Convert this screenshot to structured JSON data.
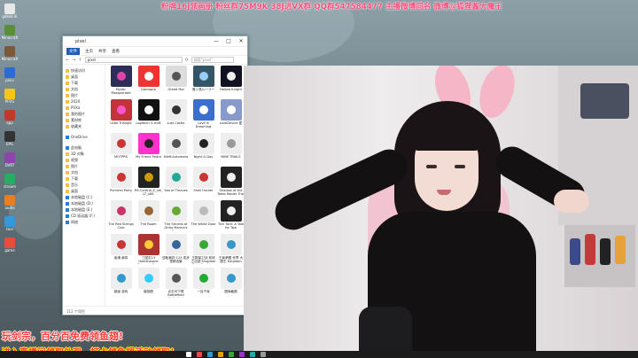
{
  "banner": {
    "text": "粉牌16J领画册 粉丝群75M9K 38J进VX群 QQ群547584477 主播微博同名 微博@狐狸酱大魔王"
  },
  "desktop_icons": [
    {
      "label": "gdkeb IE",
      "color": "#e8e8e8"
    },
    {
      "label": "Minecraft",
      "color": "#5a8f3a"
    },
    {
      "label": "Minecraft",
      "color": "#7a5a3a"
    },
    {
      "label": "pixiv",
      "color": "#2a6bd6"
    },
    {
      "label": "PFRG",
      "color": "#f5c518"
    },
    {
      "label": "app",
      "color": "#c0392b"
    },
    {
      "label": "EPG",
      "color": "#333"
    },
    {
      "label": "DVRT",
      "color": "#8e44ad"
    },
    {
      "label": "stream",
      "color": "#27ae60"
    },
    {
      "label": "audio",
      "color": "#e67e22"
    },
    {
      "label": "tool",
      "color": "#3498db"
    },
    {
      "label": "game",
      "color": "#e74c3c"
    }
  ],
  "explorer": {
    "title": "pixel",
    "ribbon_tabs": [
      "文件",
      "主页",
      "共享",
      "查看"
    ],
    "address": "pixel",
    "search_placeholder": "搜索\"pixel\"",
    "controls": {
      "minimize": "—",
      "maximize": "□",
      "close": "✕"
    },
    "nav_items": [
      {
        "label": "快速访问",
        "type": "star"
      },
      {
        "label": "桌面",
        "type": "folder"
      },
      {
        "label": "下载",
        "type": "folder"
      },
      {
        "label": "文档",
        "type": "folder"
      },
      {
        "label": "图片",
        "type": "folder"
      },
      {
        "label": "2020",
        "type": "folder"
      },
      {
        "label": "PVXa",
        "type": "folder"
      },
      {
        "label": "我的图片",
        "type": "folder"
      },
      {
        "label": "素材库",
        "type": "folder"
      },
      {
        "label": "收藏夹",
        "type": "folder"
      },
      {
        "label": "OneDrive",
        "type": "cloud"
      },
      {
        "label": "此电脑",
        "type": "pc"
      },
      {
        "label": "3D 对象",
        "type": "folder"
      },
      {
        "label": "视频",
        "type": "folder"
      },
      {
        "label": "图片",
        "type": "folder"
      },
      {
        "label": "文档",
        "type": "folder"
      },
      {
        "label": "下载",
        "type": "folder"
      },
      {
        "label": "音乐",
        "type": "folder"
      },
      {
        "label": "桌面",
        "type": "folder"
      },
      {
        "label": "本地磁盘 (C:)",
        "type": "drive"
      },
      {
        "label": "本地磁盘 (D:)",
        "type": "drive"
      },
      {
        "label": "本地磁盘 (E:)",
        "type": "drive"
      },
      {
        "label": "CD 驱动器 (F:)",
        "type": "drive"
      },
      {
        "label": "网络",
        "type": "net"
      }
    ],
    "files": [
      {
        "name": "Mystic Masquerade",
        "color": "#2d2d5a",
        "accent": "#d4a"
      },
      {
        "name": "Gomopra",
        "color": "#e33",
        "accent": "#fff"
      },
      {
        "name": "Greed Mol",
        "color": "#ddd",
        "accent": "#555"
      },
      {
        "name": "鬼ヶ島ルーラー",
        "color": "#356",
        "accent": "#9cf"
      },
      {
        "name": "Hollow Knight",
        "color": "#112",
        "accent": "#eee"
      },
      {
        "name": "Little Triangle",
        "color": "#c4323a",
        "accent": "#f5c"
      },
      {
        "name": "Logitech G HUB",
        "color": "#111",
        "accent": "#fff"
      },
      {
        "name": "Lust Castle",
        "color": "#eee",
        "accent": "#333"
      },
      {
        "name": "Love Is Dreaming",
        "color": "#3a6fd0",
        "accent": "#fff"
      },
      {
        "name": "LoveDevice 愛",
        "color": "#89c",
        "accent": "#fff"
      },
      {
        "name": "MOTPRS",
        "color": "#eee",
        "accent": "#c33"
      },
      {
        "name": "My Friend Pedro",
        "color": "#f3c",
        "accent": "#222"
      },
      {
        "name": "NieR:Automata",
        "color": "#eee",
        "accent": "#555"
      },
      {
        "name": "Night & Day",
        "color": "#eee",
        "accent": "#222"
      },
      {
        "name": "NINE TRAILS",
        "color": "#eee",
        "accent": "#999"
      },
      {
        "name": "Pummel Party",
        "color": "#eee",
        "accent": "#c33"
      },
      {
        "name": "RE:Central_E_ret_COLR_DEFAU LT_x64",
        "color": "#222",
        "accent": "#c90"
      },
      {
        "name": "Sea of Thieves",
        "color": "#eee",
        "accent": "#2a9"
      },
      {
        "name": "Shell Hunter",
        "color": "#eee",
        "accent": "#c33"
      },
      {
        "name": "Shadow of the Tomb Raider Trial",
        "color": "#222",
        "accent": "#eee"
      },
      {
        "name": "The Red Strings Club",
        "color": "#eee",
        "accent": "#c36"
      },
      {
        "name": "The Room",
        "color": "#eee",
        "accent": "#963"
      },
      {
        "name": "The Secrets of Ghita Marma's Curse",
        "color": "#eee",
        "accent": "#6a3"
      },
      {
        "name": "The White Door",
        "color": "#eee",
        "accent": "#bbb"
      },
      {
        "name": "Tick Tock: A Tale for Two",
        "color": "#222",
        "accent": "#eee"
      },
      {
        "name": "雀魂 麻将",
        "color": "#eee",
        "accent": "#c33"
      },
      {
        "name": "三国志13 Hearthstone Stranger Case Files",
        "color": "#a33",
        "accent": "#fc3"
      },
      {
        "name": "逆転裁判 123 成步堂精选集",
        "color": "#eee",
        "accent": "#369"
      },
      {
        "name": "王国保卫战 前线 之丝绒 Kingdom Rush Frontiers",
        "color": "#eee",
        "accent": "#3a3"
      },
      {
        "name": "王者荣耀 世界 大魔王 Kingdom",
        "color": "#eee",
        "accent": "#39c"
      },
      {
        "name": "超级 游戏",
        "color": "#eee",
        "accent": "#39c"
      },
      {
        "name": "缩放图",
        "color": "#eee",
        "accent": "#3cf"
      },
      {
        "name": "点击可下载 Battlefield Unlimited",
        "color": "#eee",
        "accent": "#555"
      },
      {
        "name": "一百千库",
        "color": "#eee",
        "accent": "#2a3"
      },
      {
        "name": "图库截图",
        "color": "#eee",
        "accent": "#39c"
      }
    ],
    "status": "112 个项目"
  },
  "promo": {
    "line1": "玩剑宗，百分百免费领鱼翅!",
    "line2": "进入直播间领取外观，打卡领鱼翅活动领取！"
  },
  "taskbar_icons": [
    {
      "name": "start",
      "color": "#fff"
    },
    {
      "name": "app-red",
      "color": "#e44"
    },
    {
      "name": "app-blue",
      "color": "#39c"
    },
    {
      "name": "app-orange",
      "color": "#e90"
    },
    {
      "name": "app-green",
      "color": "#3a3"
    },
    {
      "name": "app-purple",
      "color": "#93c"
    },
    {
      "name": "app-teal",
      "color": "#2aa"
    },
    {
      "name": "app-gray",
      "color": "#999"
    }
  ]
}
